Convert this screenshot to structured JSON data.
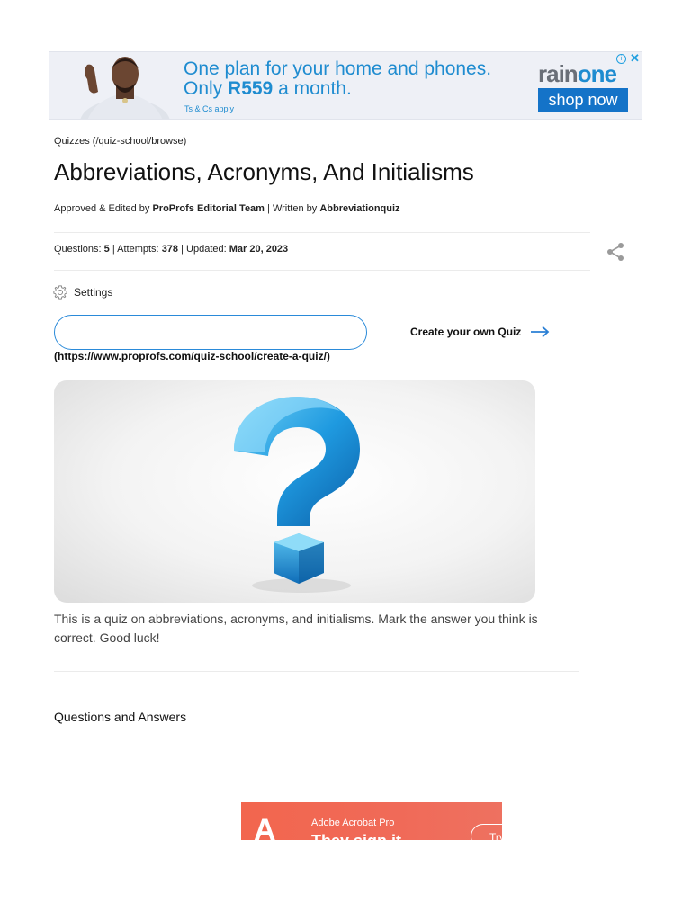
{
  "ad_top": {
    "headline_line1": "One plan for your home and phones.",
    "headline_line2_prefix": "Only",
    "headline_price": "R559",
    "headline_line2_suffix": "a month.",
    "terms": "Ts & Cs apply",
    "brand_rain": "rain",
    "brand_one": "one",
    "cta": "shop now",
    "info_icon": "info-icon",
    "close_icon": "close-icon",
    "colors": {
      "accent": "#1f8cd0",
      "button": "#1473c8"
    }
  },
  "breadcrumb": "Quizzes (/quiz-school/browse)",
  "title": "Abbreviations, Acronyms, And Initialisms",
  "byline": {
    "prefix": "Approved & Edited by",
    "editor": "ProProfs Editorial Team",
    "separator": "| Written by",
    "author": "Abbreviationquiz"
  },
  "meta": {
    "questions_label": "Questions:",
    "questions_value": "5",
    "attempts_label": "| Attempts:",
    "attempts_value": "378",
    "updated_label": "| Updated:",
    "updated_value": "Mar 20, 2023"
  },
  "share_icon": "share-icon",
  "settings": {
    "label": "Settings",
    "icon": "gear-icon"
  },
  "quiz_input": {
    "value": "",
    "placeholder": ""
  },
  "create_quiz": {
    "label": "Create your own Quiz",
    "icon": "arrow-right-icon"
  },
  "create_quiz_url": "(https://www.proprofs.com/quiz-school/create-a-quiz/)",
  "hero_image": "question-mark-image",
  "description": "This is a quiz on abbreviations, acronyms, and initialisms. Mark the answer you think is correct. Good luck!",
  "qa_heading": "Questions and Answers",
  "ad_bottom": {
    "logo": "adobe-acrobat-logo",
    "product": "Adobe Acrobat Pro",
    "tagline": "They sign it",
    "cta": "Try"
  }
}
